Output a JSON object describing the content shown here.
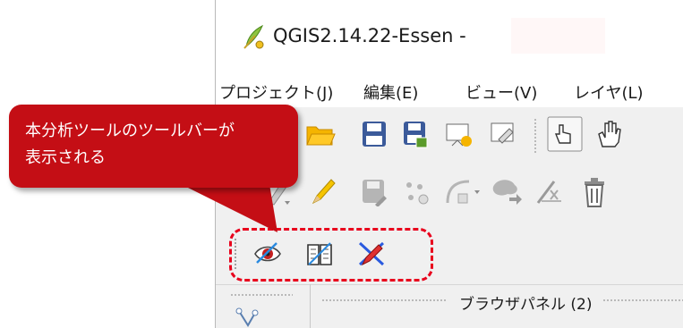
{
  "window": {
    "title": "QGIS2.14.22-Essen -"
  },
  "menu": {
    "items": [
      {
        "label": "プロジェクト(J)"
      },
      {
        "label": "編集(E)"
      },
      {
        "label": "ビュー(V)"
      },
      {
        "label": "レイヤ(L)"
      }
    ]
  },
  "toolbar_file": {
    "icons": [
      "open-folder-icon",
      "save-icon",
      "save-as-icon",
      "new-print-composer-icon",
      "composer-manager-icon",
      "touch-zoom-icon",
      "pan-hand-icon"
    ]
  },
  "toolbar_digitize": {
    "icons": [
      "current-edits-icon",
      "toggle-editing-pencil-icon",
      "save-layer-edits-icon",
      "add-point-icon",
      "add-line-icon",
      "add-polygon-icon",
      "move-feature-icon",
      "node-tool-icon",
      "delete-selected-icon"
    ]
  },
  "toolbar_plugin": {
    "icons": [
      "eye-analysis-icon",
      "book-icon",
      "pencil-cross-icon"
    ]
  },
  "callout": {
    "line1": "本分析ツールのツールバーが",
    "line2": "表示される",
    "color": "#c40e15"
  },
  "browser_panel": {
    "title": "ブラウザパネル (2)"
  },
  "colors": {
    "highlight": "#e8001c",
    "folder": "#f5b400",
    "floppy": "#3b5a9a"
  }
}
